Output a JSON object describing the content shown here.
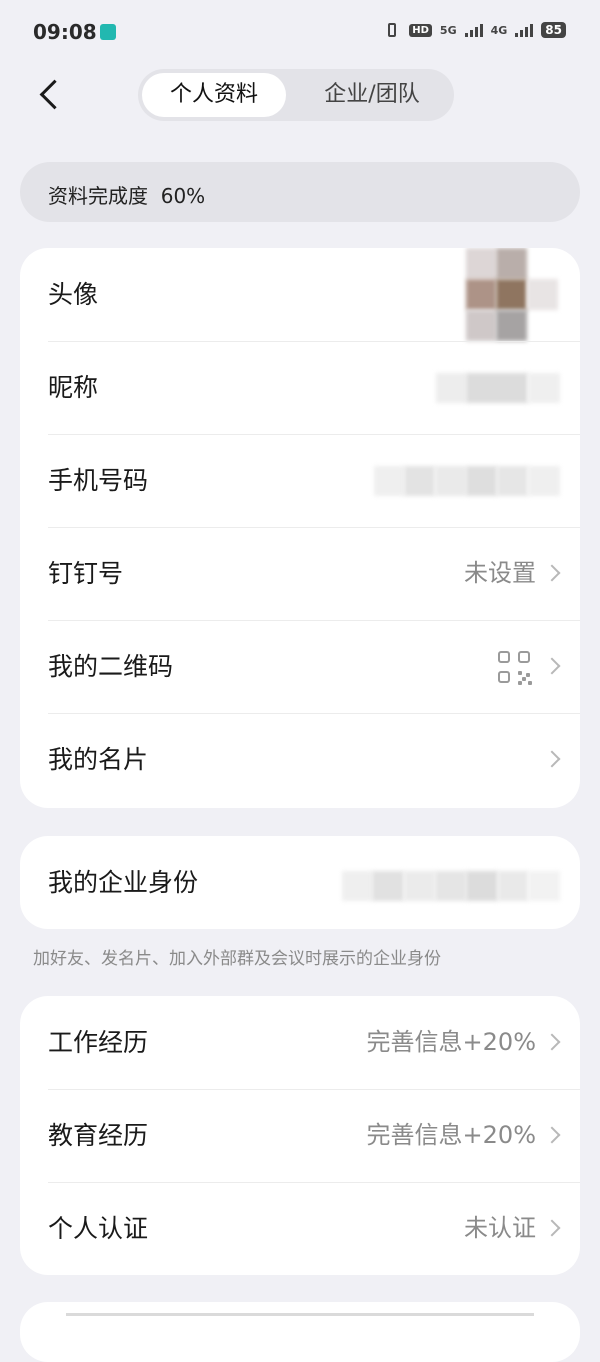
{
  "status_bar": {
    "time": "09:08",
    "hd_label": "HD",
    "net_5g": "5G",
    "net_4g": "4G",
    "battery": "85"
  },
  "nav": {
    "tabs": [
      {
        "label": "个人资料",
        "active": true
      },
      {
        "label": "企业/团队",
        "active": false
      }
    ]
  },
  "completion": {
    "label": "资料完成度",
    "value": "60%"
  },
  "profile_section": {
    "rows": [
      {
        "label": "头像"
      },
      {
        "label": "昵称"
      },
      {
        "label": "手机号码"
      },
      {
        "label": "钉钉号",
        "value": "未设置"
      },
      {
        "label": "我的二维码"
      },
      {
        "label": "我的名片"
      }
    ]
  },
  "enterprise_section": {
    "label": "我的企业身份",
    "hint": "加好友、发名片、加入外部群及会议时展示的企业身份"
  },
  "experience_section": {
    "rows": [
      {
        "label": "工作经历",
        "value": "完善信息+20%"
      },
      {
        "label": "教育经历",
        "value": "完善信息+20%"
      },
      {
        "label": "个人认证",
        "value": "未认证"
      }
    ]
  },
  "colors": {
    "background": "#f0f0f5",
    "card": "#ffffff",
    "pill": "#e3e3e8",
    "secondary_text": "#8a8a8a"
  }
}
